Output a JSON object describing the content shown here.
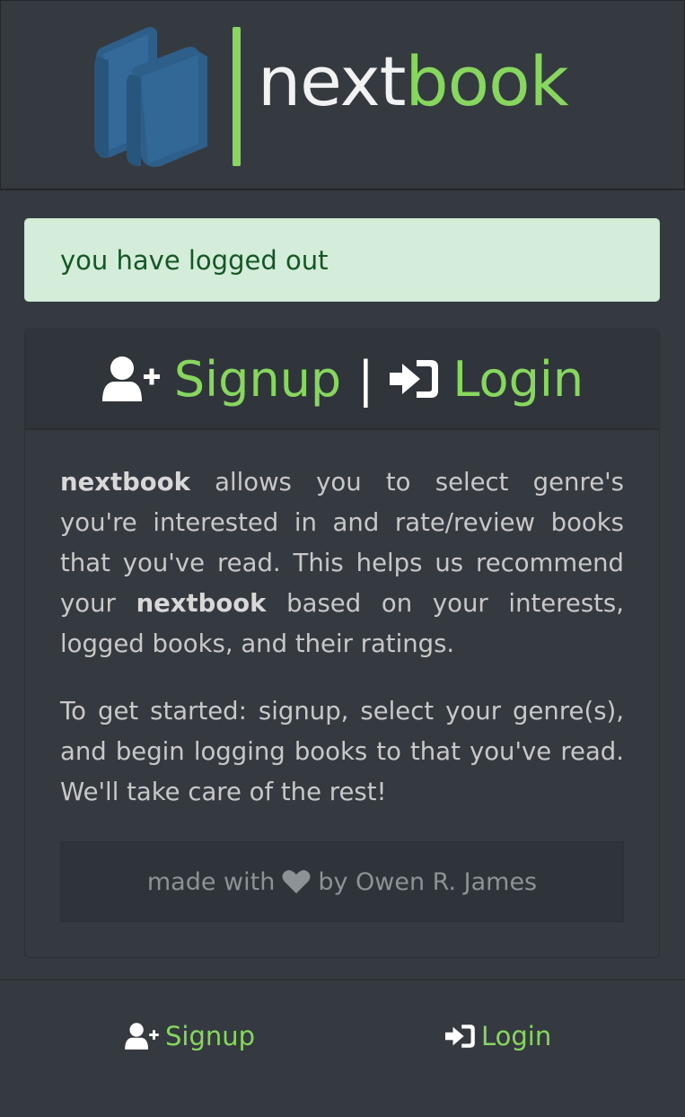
{
  "brand": {
    "name_part1": "next",
    "name_part2": "book",
    "accent_color": "#87d75f",
    "icon_color": "#2e5f8a",
    "icon": "books-icon"
  },
  "alert": {
    "message": "you have logged out",
    "color": "#d4edda"
  },
  "card": {
    "header": {
      "signup_label": "Signup",
      "separator": "|",
      "login_label": "Login"
    },
    "intro": {
      "brand_bold_1": "nextbook",
      "text_1": " allows you to select genre's you're interested in and rate/review books that you've read. This helps us recommend your ",
      "brand_bold_2": "nextbook",
      "text_2": " based on your interests, logged books, and their ratings."
    },
    "started": "To get started: signup, select your genre(s), and begin logging books to that you've read. We'll take care of the rest!",
    "credit": {
      "before": "made with",
      "icon": "heart-icon",
      "after": "by Owen R. James"
    }
  },
  "footer": {
    "signup_label": "Signup",
    "login_label": "Login"
  }
}
